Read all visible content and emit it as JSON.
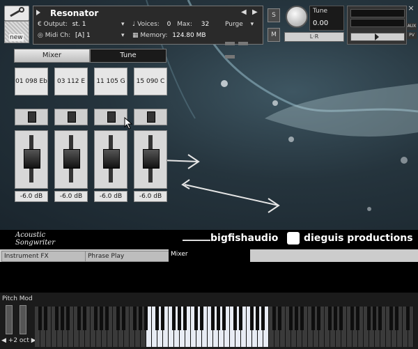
{
  "header": {
    "instrument_name": "Resonator",
    "output_label": "Output:",
    "output_value": "st. 1",
    "voices_label": "Voices:",
    "voices_value": "0",
    "max_label": "Max:",
    "max_value": "32",
    "purge_label": "Purge",
    "midi_label": "Midi Ch:",
    "midi_value": "[A]  1",
    "memory_label": "Memory:",
    "memory_value": "124.80 MB",
    "solo_label": "S",
    "mute_label": "M",
    "tune_label": "Tune",
    "tune_value": "0.00",
    "new_label": "new",
    "pan_label": "L·R",
    "aux_label": "AUX",
    "pv_label": "PV"
  },
  "tabs": {
    "mixer": "Mixer",
    "tune": "Tune"
  },
  "channels": [
    {
      "name": "01 098 Eb",
      "gain": "-6.0 dB"
    },
    {
      "name": "03 112 E",
      "gain": "-6.0 dB"
    },
    {
      "name": "11 105 G",
      "gain": "-6.0 dB"
    },
    {
      "name": "15 090 C",
      "gain": "-6.0 dB"
    }
  ],
  "logos": {
    "acoustic_line1": "Acoustic",
    "acoustic_line2": "Songwriter",
    "bigfish": "bigfishaudio",
    "dieguis": "dieguis productions"
  },
  "bottom_tabs": {
    "instrument_fx": "Instrument FX",
    "phrase_play": "Phrase Play",
    "mixer": "Mixer"
  },
  "keyboard": {
    "pitch_mod_label": "Pitch Mod",
    "octave_label": "+2 oct"
  },
  "colors": {
    "background_art": "#25343d",
    "active_keys": "#e8ecf4"
  }
}
